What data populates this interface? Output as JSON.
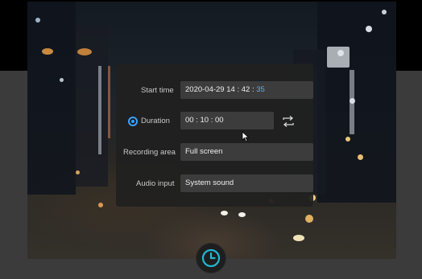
{
  "dialog": {
    "start_time": {
      "label": "Start time",
      "date": "2020-04-29",
      "hour": "14",
      "minute": "42",
      "second": "35",
      "separator": ":"
    },
    "duration": {
      "label": "Duration",
      "value": "00 : 10 : 00",
      "selected": true
    },
    "recording_area": {
      "label": "Recording area",
      "value": "Full screen"
    },
    "audio_input": {
      "label": "Audio input",
      "value": "System sound"
    }
  },
  "icons": {
    "loop": "repeat-icon",
    "timer": "timer-clock-icon",
    "cursor": "mouse-cursor-icon"
  },
  "colors": {
    "accent": "#3aa3ff",
    "seconds_highlight": "#4fb3ff",
    "timer_ring": "#21b8d6"
  }
}
